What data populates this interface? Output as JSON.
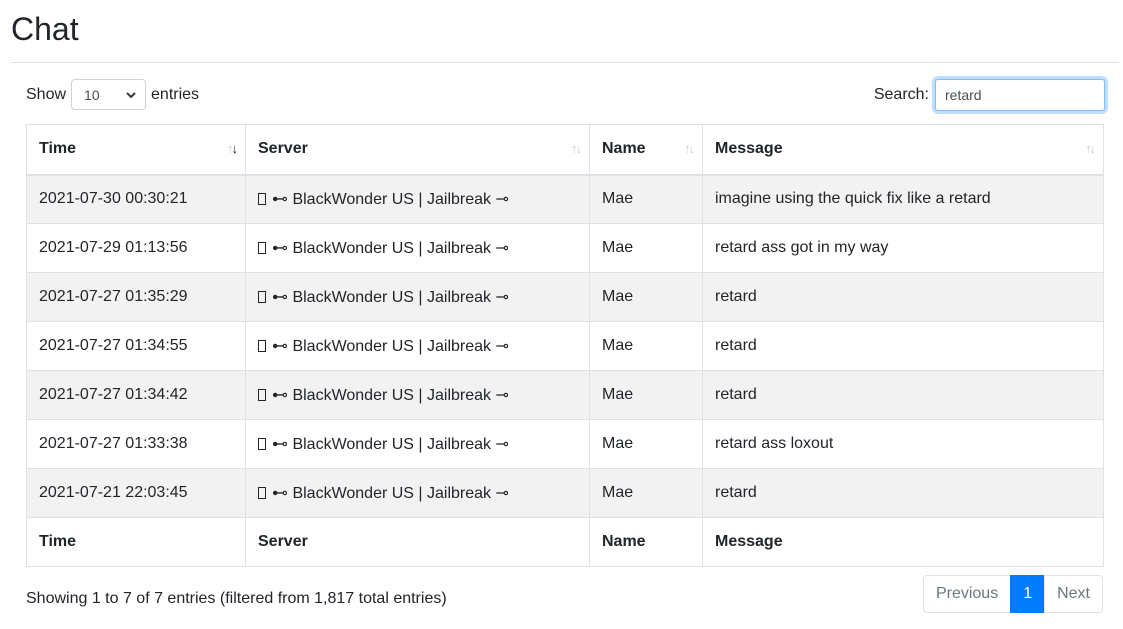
{
  "page": {
    "title": "Chat"
  },
  "controls": {
    "show_label": "Show",
    "entries_label": "entries",
    "length_value": "10",
    "search_label": "Search:",
    "search_value": "retard"
  },
  "table": {
    "headers": [
      "Time",
      "Server",
      "Name",
      "Message"
    ],
    "footers": [
      "Time",
      "Server",
      "Name",
      "Message"
    ],
    "rows": [
      {
        "time": "2021-07-30 00:30:21",
        "server": "⊷ BlackWonder US | Jailbreak ⊸",
        "name": "Mae",
        "message": "imagine using the quick fix like a retard"
      },
      {
        "time": "2021-07-29 01:13:56",
        "server": "⊷ BlackWonder US | Jailbreak ⊸",
        "name": "Mae",
        "message": "retard ass got in my way"
      },
      {
        "time": "2021-07-27 01:35:29",
        "server": "⊷ BlackWonder US | Jailbreak ⊸",
        "name": "Mae",
        "message": "retard"
      },
      {
        "time": "2021-07-27 01:34:55",
        "server": "⊷ BlackWonder US | Jailbreak ⊸",
        "name": "Mae",
        "message": "retard"
      },
      {
        "time": "2021-07-27 01:34:42",
        "server": "⊷ BlackWonder US | Jailbreak ⊸",
        "name": "Mae",
        "message": "retard"
      },
      {
        "time": "2021-07-27 01:33:38",
        "server": "⊷ BlackWonder US | Jailbreak ⊸",
        "name": "Mae",
        "message": "retard ass loxout"
      },
      {
        "time": "2021-07-21 22:03:45",
        "server": "⊷ BlackWonder US | Jailbreak ⊸",
        "name": "Mae",
        "message": "retard"
      }
    ]
  },
  "info": {
    "text": "Showing 1 to 7 of 7 entries (filtered from 1,817 total entries)"
  },
  "pagination": {
    "previous": "Previous",
    "current": "1",
    "next": "Next"
  },
  "colors": {
    "accent": "#007bff",
    "stripe": "#f2f2f2",
    "border": "#dee2e6"
  }
}
